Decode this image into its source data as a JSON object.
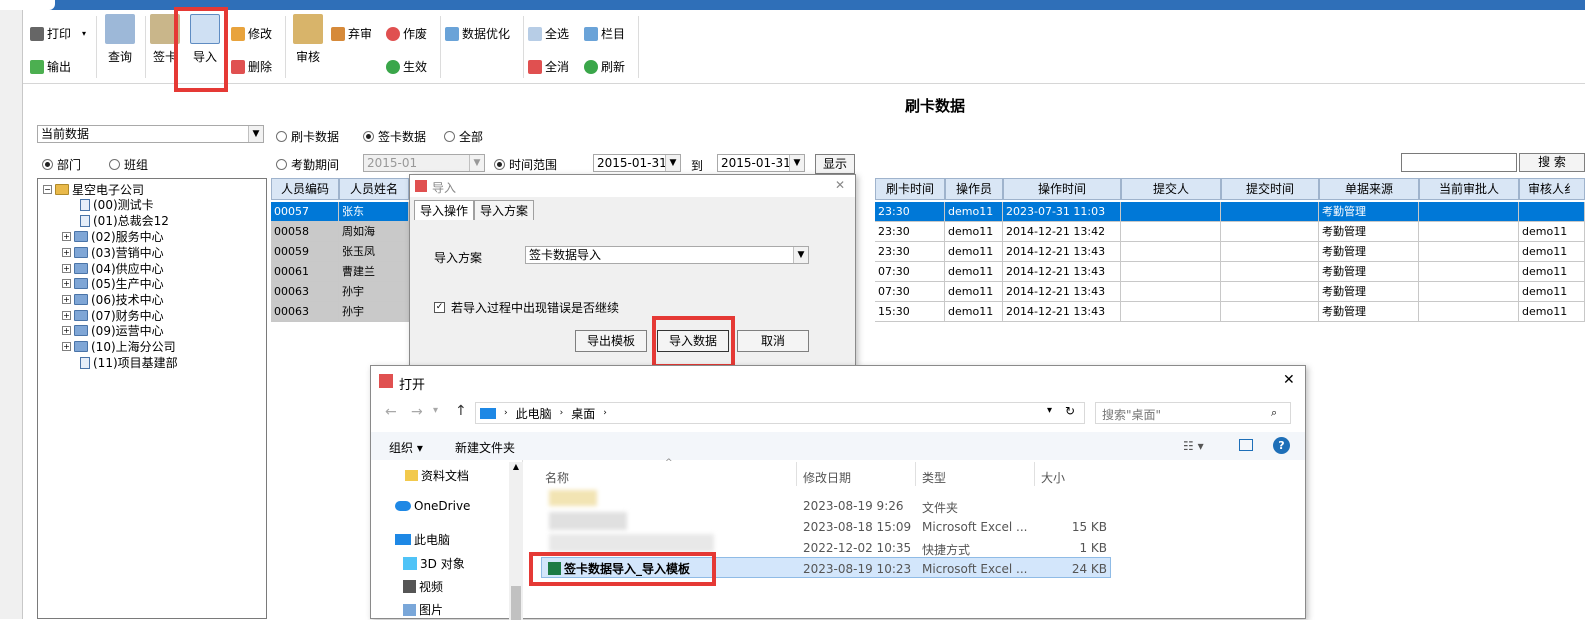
{
  "ribbon": {
    "print": "打印",
    "export": "输出",
    "query": "查询",
    "sign": "签卡",
    "import": "导入",
    "modify": "修改",
    "delete": "删除",
    "audit": "审核",
    "abandon": "弃审",
    "void": "作废",
    "effect": "生效",
    "optimize": "数据优化",
    "select_all": "全选",
    "columns": "栏目",
    "deselect_all": "全消",
    "refresh": "刷新"
  },
  "page": {
    "title": "刷卡数据"
  },
  "filter": {
    "data_combo": "当前数据",
    "radio_swipe": "刷卡数据",
    "radio_sign": "签卡数据",
    "radio_all": "全部",
    "radio_dept": "部门",
    "radio_team": "班组",
    "radio_period": "考勤期间",
    "period_value": "2015-01",
    "radio_range": "时间范围",
    "date_from": "2015-01-31",
    "to_label": "到",
    "date_to": "2015-01-31",
    "show_btn": "显示",
    "search_btn": "搜 索"
  },
  "tree": {
    "root": "星空电子公司",
    "items": [
      "(00)测试卡",
      "(01)总裁会12",
      "(02)服务中心",
      "(03)营销中心",
      "(04)供应中心",
      "(05)生产中心",
      "(06)技术中心",
      "(07)财务中心",
      "(09)运营中心",
      "(10)上海分公司",
      "(11)项目基建部"
    ]
  },
  "grid": {
    "headers": [
      "人员编码",
      "人员姓名",
      "刷卡时间",
      "操作员",
      "操作时间",
      "提交人",
      "提交时间",
      "单据来源",
      "当前审批人",
      "审核人纟"
    ],
    "rows": [
      {
        "code": "00057",
        "name": "张东",
        "time": "23:30",
        "op": "demo11",
        "optime": "2023-07-31 11:03",
        "source": "考勤管理",
        "auditor": ""
      },
      {
        "code": "00058",
        "name": "周如海",
        "time": "23:30",
        "op": "demo11",
        "optime": "2014-12-21 13:42",
        "source": "考勤管理",
        "auditor": "demo11"
      },
      {
        "code": "00059",
        "name": "张玉凤",
        "time": "23:30",
        "op": "demo11",
        "optime": "2014-12-21 13:43",
        "source": "考勤管理",
        "auditor": "demo11"
      },
      {
        "code": "00061",
        "name": "曹建兰",
        "time": "07:30",
        "op": "demo11",
        "optime": "2014-12-21 13:43",
        "source": "考勤管理",
        "auditor": "demo11"
      },
      {
        "code": "00063",
        "name": "孙宇",
        "time": "07:30",
        "op": "demo11",
        "optime": "2014-12-21 13:43",
        "source": "考勤管理",
        "auditor": "demo11"
      },
      {
        "code": "00063",
        "name": "孙宇",
        "time": "15:30",
        "op": "demo11",
        "optime": "2014-12-21 13:43",
        "source": "考勤管理",
        "auditor": "demo11"
      }
    ]
  },
  "import_dialog": {
    "title": "导入",
    "tab1": "导入操作",
    "tab2": "导入方案",
    "close": "✕",
    "scheme_label": "导入方案",
    "scheme_value": "签卡数据导入",
    "continue_label": "若导入过程中出现错误是否继续",
    "export_tpl": "导出模板",
    "import_data": "导入数据",
    "cancel": "取消"
  },
  "open_dialog": {
    "title": "打开",
    "close": "✕",
    "path_pc": "此电脑",
    "path_desktop": "桌面",
    "search_placeholder": "搜索\"桌面\"",
    "organize": "组织",
    "new_folder": "新建文件夹",
    "nav": [
      "资料文档",
      "OneDrive",
      "此电脑",
      "3D 对象",
      "视频",
      "图片"
    ],
    "cols": [
      "名称",
      "修改日期",
      "类型",
      "大小"
    ],
    "files": [
      {
        "name": "",
        "date": "2023-08-19 9:26",
        "type": "文件夹",
        "size": ""
      },
      {
        "name": "",
        "date": "2023-08-18 15:09",
        "type": "Microsoft Excel ...",
        "size": "15 KB"
      },
      {
        "name": "",
        "date": "2022-12-02 10:35",
        "type": "快捷方式",
        "size": "1 KB"
      },
      {
        "name": "签卡数据导入_导入模板",
        "date": "2023-08-19 10:23",
        "type": "Microsoft Excel ...",
        "size": "24 KB"
      }
    ]
  },
  "colors": {
    "accent": "#2f6fb8",
    "selection": "#0078d7",
    "highlight_box": "#e53935"
  }
}
